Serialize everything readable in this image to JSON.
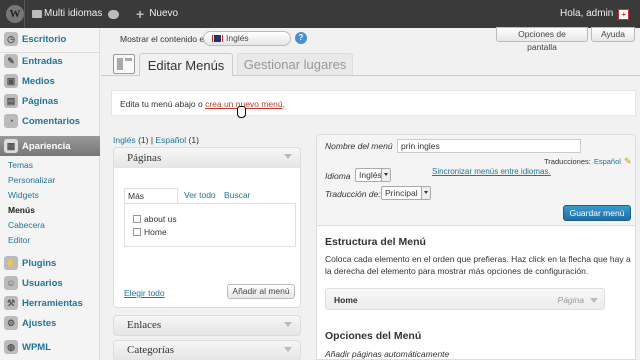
{
  "adminbar": {
    "site": "Multi idiomas",
    "new_label": "Nuevo",
    "greeting": "Hola, admin"
  },
  "sidebar": {
    "items": [
      {
        "label": "Escritorio"
      },
      {
        "label": "Entradas"
      },
      {
        "label": "Medios"
      },
      {
        "label": "Páginas"
      },
      {
        "label": "Comentarios"
      },
      {
        "label": "Apariencia"
      },
      {
        "label": "Plugins"
      },
      {
        "label": "Usuarios"
      },
      {
        "label": "Herramientas"
      },
      {
        "label": "Ajustes"
      },
      {
        "label": "WPML"
      }
    ],
    "subitems": [
      "Temas",
      "Personalizar",
      "Widgets",
      "Menús",
      "Cabecera",
      "Editor"
    ]
  },
  "header": {
    "content_label": "Mostrar el contenido en:",
    "language": "Inglés",
    "help_mark": "?",
    "screen_options": "Opciones de pantalla",
    "help": "Ayuda"
  },
  "tabs": {
    "edit": "Editar Menús",
    "manage": "Gestionar lugares"
  },
  "notice": {
    "text": "Edita tu menú abajo o ",
    "link": "crea un nuevo menú",
    "end": "."
  },
  "lang_switch": {
    "en": "Inglés",
    "en_count": "(1)",
    "sep": "|",
    "es": "Español",
    "es_count": "(1)"
  },
  "pages_box": {
    "title": "Páginas",
    "tabs": [
      "Más reciente",
      "Ver todo",
      "Buscar"
    ],
    "items": [
      "about us",
      "Home"
    ],
    "select_all": "Elegir todo",
    "add_button": "Añadir al menú"
  },
  "links_box": {
    "title": "Enlaces"
  },
  "categories_box": {
    "title": "Categorías"
  },
  "menu_settings": {
    "name_label": "Nombre del menú",
    "name_value": "prin ingles",
    "translations_label": "Traducciones:",
    "translations_link": "Español",
    "lang_label": "Idioma",
    "lang_value": "Inglés",
    "sync_link": "Sincronizar menús entre idiomas.",
    "translation_of_label": "Traducción de:",
    "translation_of_value": "Principal",
    "save_button": "Guardar menú"
  },
  "structure": {
    "title": "Estructura del Menú",
    "desc": "Coloca cada elemento en el orden que prefieras. Haz click en la flecha que hay a la derecha del elemento para mostrar más opciones de configuración.",
    "item_title": "Home",
    "item_type": "Página"
  },
  "options": {
    "title": "Opciones del Menú",
    "auto_add": "Añadir páginas automáticamente"
  }
}
